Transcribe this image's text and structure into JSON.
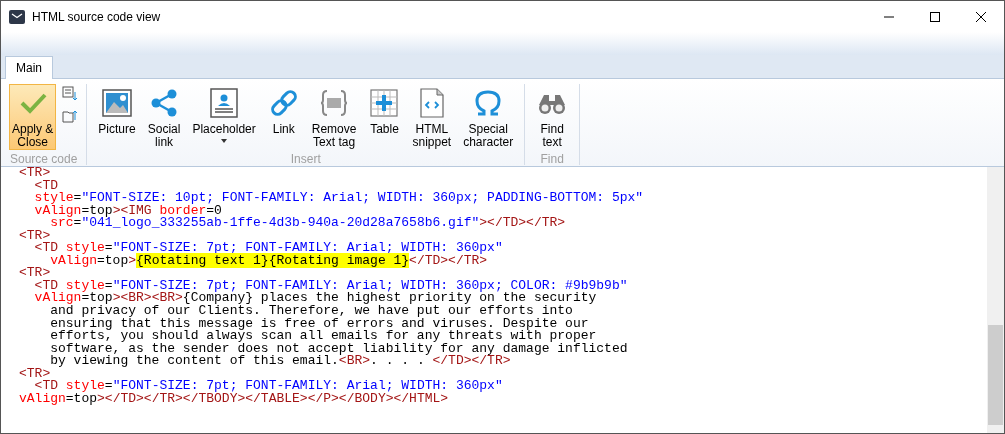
{
  "window": {
    "title": "HTML source code view"
  },
  "tabs": [
    {
      "label": "Main",
      "selected": true
    }
  ],
  "ribbon": {
    "groups": [
      {
        "label": "Source code",
        "buttons": [
          {
            "label": "Apply &\nClose",
            "selected": true,
            "dropdown": false
          }
        ]
      },
      {
        "label": "Insert",
        "buttons": [
          {
            "label": "Picture",
            "selected": false,
            "dropdown": false
          },
          {
            "label": "Social\nlink",
            "selected": false,
            "dropdown": false
          },
          {
            "label": "Placeholder",
            "selected": false,
            "dropdown": true
          },
          {
            "label": "Link",
            "selected": false,
            "dropdown": false
          },
          {
            "label": "Remove\nText tag",
            "selected": false,
            "dropdown": false
          },
          {
            "label": "Table",
            "selected": false,
            "dropdown": false
          },
          {
            "label": "HTML\nsnippet",
            "selected": false,
            "dropdown": false
          },
          {
            "label": "Special\ncharacter",
            "selected": false,
            "dropdown": false
          }
        ]
      },
      {
        "label": "Find",
        "buttons": [
          {
            "label": "Find\ntext",
            "selected": false,
            "dropdown": false
          }
        ]
      }
    ]
  },
  "code_lines": [
    [
      {
        "kind": "tag",
        "text": "<TR>"
      }
    ],
    [
      {
        "kind": "tag",
        "text": "  <TD"
      }
    ],
    [
      {
        "kind": "attr",
        "text": "  style"
      },
      {
        "kind": "plain",
        "text": "="
      },
      {
        "kind": "value",
        "text": "\"FONT-SIZE: 10pt; FONT-FAMILY: Arial; WIDTH: 360px; PADDING-BOTTOM: 5px\""
      }
    ],
    [
      {
        "kind": "attr",
        "text": "  vAlign"
      },
      {
        "kind": "plain",
        "text": "=top"
      },
      {
        "kind": "tag",
        "text": "><IMG"
      },
      {
        "kind": "attr",
        "text": " border"
      },
      {
        "kind": "plain",
        "text": "=0"
      }
    ],
    [
      {
        "kind": "attr",
        "text": "    src"
      },
      {
        "kind": "plain",
        "text": "="
      },
      {
        "kind": "value",
        "text": "\"041_logo_333255ab-1ffe-4d3b-940a-20d28a7658b6.gif\""
      },
      {
        "kind": "tag",
        "text": "></TD></TR>"
      }
    ],
    [
      {
        "kind": "tag",
        "text": "<TR>"
      }
    ],
    [
      {
        "kind": "tag",
        "text": "  <TD"
      },
      {
        "kind": "attr",
        "text": " style"
      },
      {
        "kind": "plain",
        "text": "="
      },
      {
        "kind": "value",
        "text": "\"FONT-SIZE: 7pt; FONT-FAMILY: Arial; WIDTH: 360px\""
      }
    ],
    [
      {
        "kind": "attr",
        "text": "    vAlign"
      },
      {
        "kind": "plain",
        "text": "=top"
      },
      {
        "kind": "tag",
        "text": ">"
      },
      {
        "kind": "highlight",
        "text": "{Rotating text 1}{Rotating image 1}"
      },
      {
        "kind": "tag",
        "text": "</TD></TR>"
      }
    ],
    [
      {
        "kind": "tag",
        "text": "<TR>"
      }
    ],
    [
      {
        "kind": "tag",
        "text": "  <TD"
      },
      {
        "kind": "attr",
        "text": " style"
      },
      {
        "kind": "plain",
        "text": "="
      },
      {
        "kind": "value",
        "text": "\"FONT-SIZE: 7pt; FONT-FAMILY: Arial; WIDTH: 360px; COLOR: #9b9b9b\""
      }
    ],
    [
      {
        "kind": "attr",
        "text": "  vAlign"
      },
      {
        "kind": "plain",
        "text": "=top"
      },
      {
        "kind": "tag",
        "text": "><BR><BR>"
      },
      {
        "kind": "plain",
        "text": "{Company} places the highest priority on the security"
      }
    ],
    [
      {
        "kind": "plain",
        "text": "    and privacy of our Clients. Therefore, we have put our efforts into"
      }
    ],
    [
      {
        "kind": "plain",
        "text": "    ensuring that this message is free of errors and viruses. Despite our"
      }
    ],
    [
      {
        "kind": "plain",
        "text": "    efforts, you should always scan all emails for any threats with proper"
      }
    ],
    [
      {
        "kind": "plain",
        "text": "    software, as the sender does not accept liability for any damage inflicted"
      }
    ],
    [
      {
        "kind": "plain",
        "text": "    by viewing the content of this email."
      },
      {
        "kind": "tag",
        "text": "<BR>"
      },
      {
        "kind": "plain",
        "text": ". . . . "
      },
      {
        "kind": "tag",
        "text": "</TD></TR>"
      }
    ],
    [
      {
        "kind": "tag",
        "text": "<TR>"
      }
    ],
    [
      {
        "kind": "tag",
        "text": "  <TD"
      },
      {
        "kind": "attr",
        "text": " style"
      },
      {
        "kind": "plain",
        "text": "="
      },
      {
        "kind": "value",
        "text": "\"FONT-SIZE: 7pt; FONT-FAMILY: Arial; WIDTH: 360px\""
      }
    ],
    [
      {
        "kind": "attr",
        "text": "vAlign"
      },
      {
        "kind": "plain",
        "text": "=top"
      },
      {
        "kind": "tag",
        "text": "></TD></TR></TBODY></TABLE></P></BODY></HTML>"
      }
    ]
  ]
}
